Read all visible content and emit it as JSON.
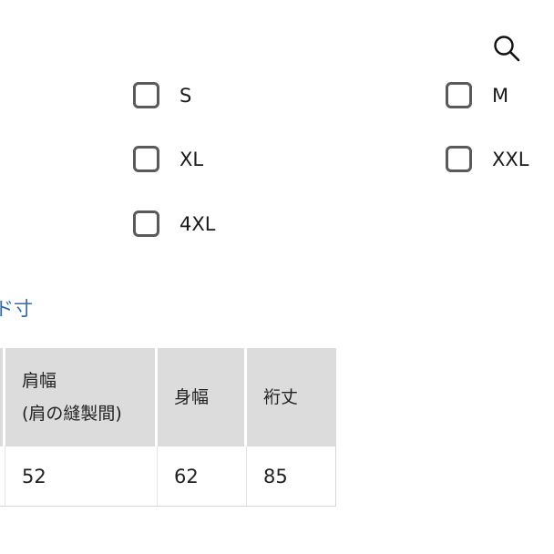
{
  "header": {
    "search_icon": "search-icon"
  },
  "size_filter": {
    "options": [
      {
        "label": "S",
        "checked": false
      },
      {
        "label": "M",
        "checked": false
      },
      {
        "label": "XL",
        "checked": false
      },
      {
        "label": "XXL",
        "checked": false
      },
      {
        "label": "4XL",
        "checked": false
      }
    ]
  },
  "size_guide": {
    "link_text": "ド寸"
  },
  "size_table": {
    "headers": [
      {
        "label": "肩幅",
        "sub": "(肩の縫製間)"
      },
      {
        "label": "身幅",
        "sub": ""
      },
      {
        "label": "裄丈",
        "sub": ""
      }
    ],
    "rows": [
      [
        "52",
        "62",
        "85"
      ]
    ]
  },
  "colors": {
    "link": "#2a6cb0",
    "header_bg": "#dcdcdc",
    "checkbox_border": "#5a5a5a"
  }
}
